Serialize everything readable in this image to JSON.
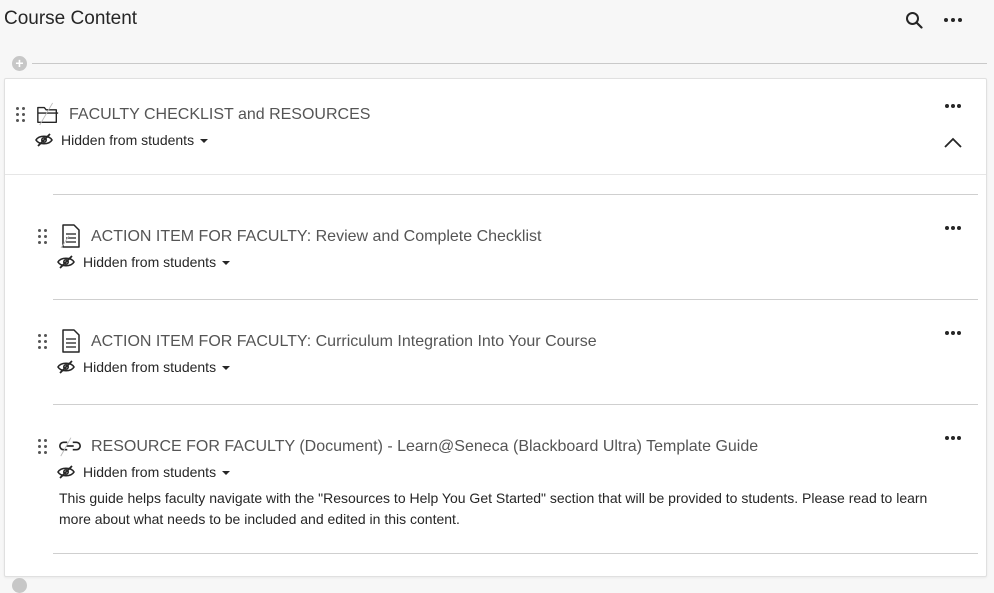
{
  "header": {
    "title": "Course Content",
    "search_icon": "search-icon",
    "more_icon": "more-options-icon"
  },
  "folder": {
    "title": "FACULTY CHECKLIST and RESOURCES",
    "visibility": "Hidden from students",
    "icon": "folder-icon"
  },
  "items": [
    {
      "title": "ACTION ITEM FOR FACULTY: Review and Complete Checklist",
      "visibility": "Hidden from students",
      "icon": "document-icon"
    },
    {
      "title": "ACTION ITEM FOR FACULTY: Curriculum Integration Into Your Course",
      "visibility": "Hidden from students",
      "icon": "document-icon"
    },
    {
      "title": "RESOURCE FOR FACULTY (Document) - Learn@Seneca (Blackboard Ultra) Template Guide",
      "visibility": "Hidden from students",
      "icon": "link-icon",
      "description": "This guide helps faculty navigate with the \"Resources to Help You Get Started\" section that will be provided to students. Please read to learn more about what needs to be included and edited in this content."
    }
  ],
  "colors": {
    "background": "#f7f7f7",
    "card": "#ffffff",
    "text": "#262626",
    "title_text": "#555555"
  }
}
